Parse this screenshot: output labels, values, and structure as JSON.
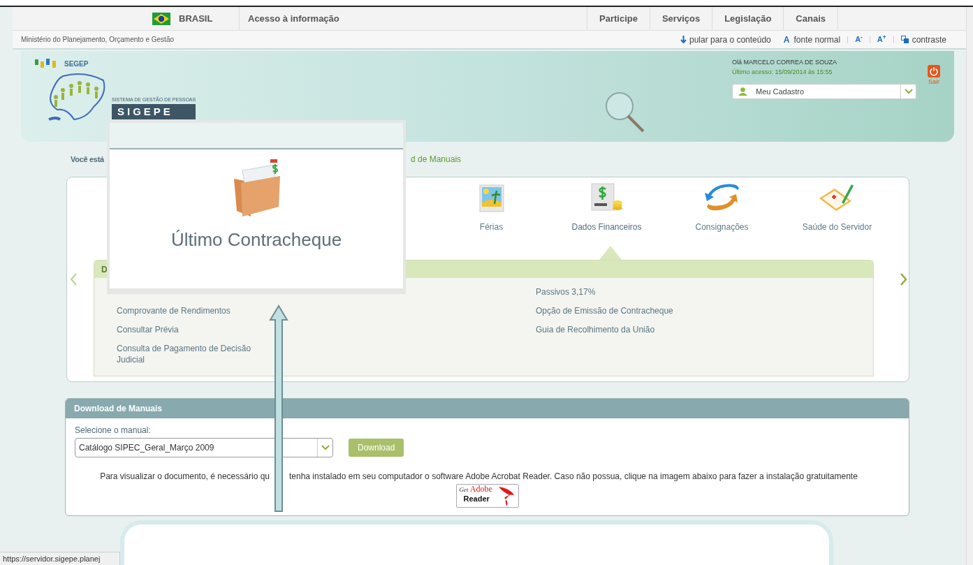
{
  "gov_bar": {
    "country": "BRASIL",
    "link": "Acesso à informação",
    "menu": [
      "Participe",
      "Serviços",
      "Legislação",
      "Canais"
    ]
  },
  "ministry_bar": {
    "ministry": "Ministério do Planejamento, Orçamento e Gestão",
    "accessibility": [
      {
        "kind": "skip",
        "label": "pular para o conteúdo"
      },
      {
        "kind": "font",
        "glyph": "A",
        "label": "fonte normal"
      },
      {
        "kind": "size",
        "label": "A$^{-}$"
      },
      {
        "kind": "size",
        "label": "A$^{+}$"
      },
      {
        "kind": "contrast",
        "label": "contraste"
      }
    ]
  },
  "header": {
    "org": "SEGEP",
    "system_caption": "SISTEMA DE GESTÃO DE PESSOAS",
    "system_name": "SIGEPE",
    "greeting": "Olá MARCELO CORREA DE SOUZA",
    "last_access": "Último acesso: 15/09/2014 às 15:55",
    "profile_select": {
      "value": "Meu Cadastro"
    },
    "logout": "Sair"
  },
  "breadcrumb": {
    "start": "Você está",
    "end": "d de Manuais"
  },
  "services": [
    {
      "kind": "beach",
      "label": "Férias",
      "selected": false
    },
    {
      "kind": "money",
      "label": "Dados Financeiros",
      "selected": true
    },
    {
      "kind": "exchange",
      "label": "Consignações",
      "selected": false
    },
    {
      "kind": "health",
      "label": "Saúde do Servidor",
      "selected": false
    }
  ],
  "detail_panel": {
    "title": "D",
    "left": [
      "Comprovante de Rendimentos",
      "Consultar Prévia",
      "Consulta de Pagamento de Decisão Judicial"
    ],
    "right": [
      "Passivos 3,17%",
      "Opção de Emissão de Contracheque",
      "Guia de Recolhimento da União"
    ]
  },
  "downloads": {
    "title": "Download de Manuais",
    "label": "Selecione o manual:",
    "select_value": "Catálogo SIPEC_Geral_Março 2009",
    "button": "Download",
    "notice": [
      "Para visualizar o documento, é necessário qu",
      "tenha instalado em seu computador o software Adobe Acrobat Reader. Caso não possua, clique na imagem abaixo para fazer a instalação gratuitamente"
    ],
    "reader_badge": {
      "get": "Get",
      "brand": "Adobe",
      "product": "Reader"
    }
  },
  "popup": {
    "title": "Último Contracheque"
  },
  "status_url": "https://servidor.sigepe.planej"
}
